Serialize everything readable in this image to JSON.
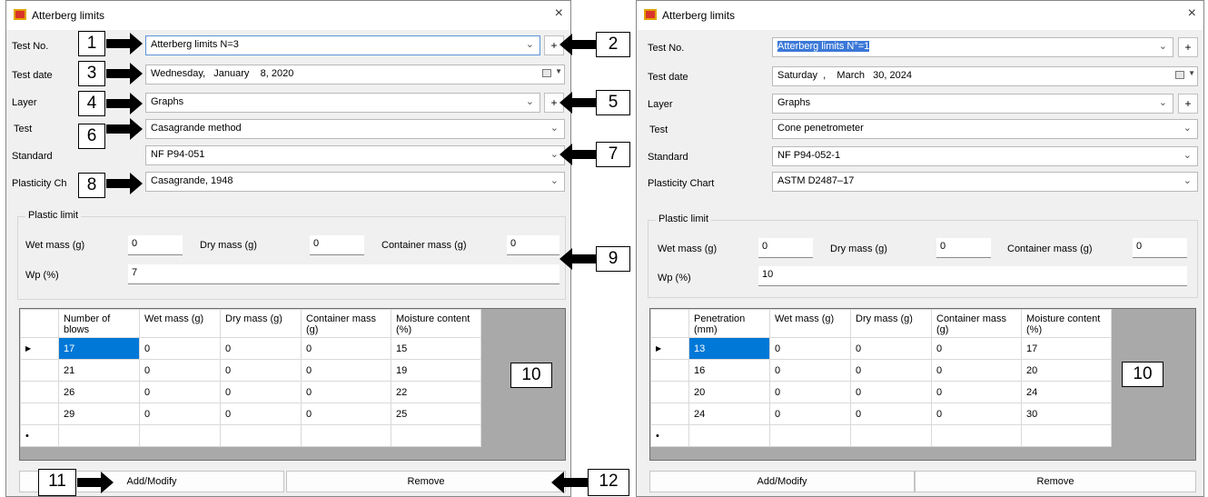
{
  "left": {
    "title": "Atterberg limits",
    "close_icon": "×",
    "labels": {
      "test_no": "Test No.",
      "test_date": "Test date",
      "layer": "Layer",
      "test": "Test",
      "standard": "Standard",
      "plasticity_chart": "Plasticity Ch"
    },
    "test_no_value": "Atterberg limits N=3",
    "test_date_value": "Wednesday,   January    8, 2020",
    "layer_value": "Graphs",
    "test_value": "Casagrande method",
    "standard_value": "NF P94-051",
    "plasticity_value": "Casagrande, 1948",
    "plus_label": "+",
    "plastic": {
      "title": "Plastic limit",
      "wet_label": "Wet mass (g)",
      "wet": "0",
      "dry_label": "Dry mass (g)",
      "dry": "0",
      "cont_label": "Container mass (g)",
      "cont": "0",
      "wp_label": "Wp (%)",
      "wp": "7"
    },
    "table": {
      "headers": [
        "Number of blows",
        "Wet mass (g)",
        "Dry mass (g)",
        "Container mass (g)",
        "Moisture content (%)"
      ],
      "rows": [
        [
          "17",
          "0",
          "0",
          "0",
          "15"
        ],
        [
          "21",
          "0",
          "0",
          "0",
          "19"
        ],
        [
          "26",
          "0",
          "0",
          "0",
          "22"
        ],
        [
          "29",
          "0",
          "0",
          "0",
          "25"
        ]
      ]
    },
    "add_label": "Add/Modify",
    "remove_label": "Remove"
  },
  "right": {
    "title": "Atterberg limits",
    "close_icon": "×",
    "labels": {
      "test_no": "Test No.",
      "test_date": "Test date",
      "layer": "Layer",
      "test": "Test",
      "standard": "Standard",
      "plasticity_chart": "Plasticity Chart"
    },
    "test_no_value": "Atterberg limits N°=1",
    "test_date_value": "Saturday  ,    March   30, 2024",
    "layer_value": "Graphs",
    "test_value": "Cone penetrometer",
    "standard_value": "NF P94-052-1",
    "plasticity_value": "ASTM D2487–17",
    "plus_label": "+",
    "plastic": {
      "title": "Plastic limit",
      "wet_label": "Wet mass (g)",
      "wet": "0",
      "dry_label": "Dry mass (g)",
      "dry": "0",
      "cont_label": "Container mass (g)",
      "cont": "0",
      "wp_label": "Wp (%)",
      "wp": "10"
    },
    "table": {
      "headers": [
        "Penetration (mm)",
        "Wet mass (g)",
        "Dry mass (g)",
        "Container mass (g)",
        "Moisture content (%)"
      ],
      "rows": [
        [
          "13",
          "0",
          "0",
          "0",
          "17"
        ],
        [
          "16",
          "0",
          "0",
          "0",
          "20"
        ],
        [
          "20",
          "0",
          "0",
          "0",
          "24"
        ],
        [
          "24",
          "0",
          "0",
          "0",
          "30"
        ]
      ]
    },
    "add_label": "Add/Modify",
    "remove_label": "Remove"
  },
  "callouts": [
    "1",
    "2",
    "3",
    "4",
    "5",
    "6",
    "7",
    "8",
    "9",
    "10",
    "11",
    "12",
    "10"
  ]
}
